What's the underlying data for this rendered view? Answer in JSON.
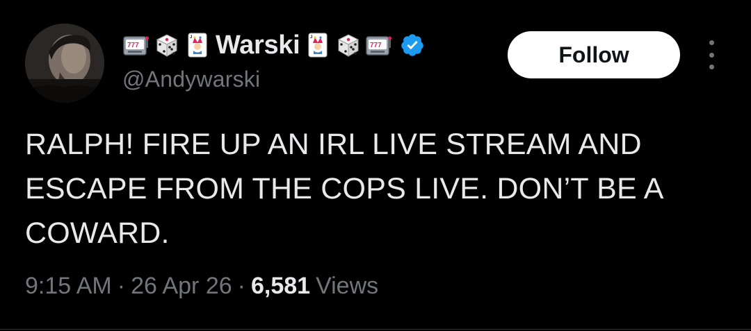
{
  "author": {
    "display_name": "Warski",
    "handle": "@Andywarski",
    "verified": true,
    "emojis_before": [
      "slot-machine-icon",
      "dice-icon",
      "joker-card-icon"
    ],
    "emojis_after": [
      "joker-card-icon",
      "dice-icon",
      "slot-machine-icon"
    ]
  },
  "follow_button": {
    "label": "Follow"
  },
  "tweet": {
    "text": "RALPH! FIRE UP AN IRL LIVE STREAM AND ESCAPE FROM THE COPS LIVE. DON’T BE A COWARD."
  },
  "meta": {
    "time": "9:15 AM",
    "separator": "·",
    "date": "26 Apr 26",
    "views_count": "6,581",
    "views_label": "Views"
  },
  "colors": {
    "background": "#000000",
    "text_primary": "#e7e9ea",
    "text_secondary": "#71767b",
    "verified_badge": "#1d9bf0",
    "follow_bg": "#ffffff"
  }
}
